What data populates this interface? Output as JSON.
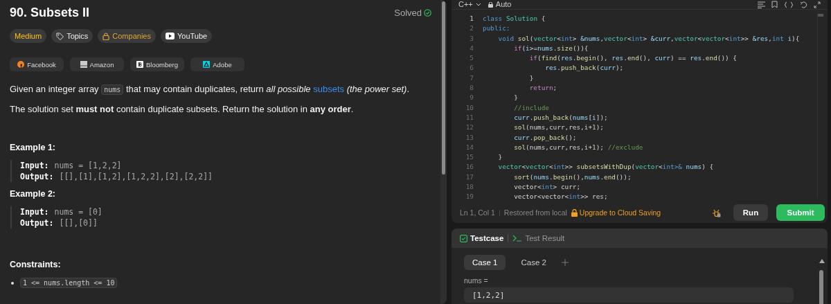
{
  "problem": {
    "title": "90. Subsets II",
    "status": "Solved",
    "tags": [
      {
        "label": "Medium",
        "kind": "difficulty"
      },
      {
        "label": "Topics",
        "kind": "topics"
      },
      {
        "label": "Companies",
        "kind": "companies"
      },
      {
        "label": "YouTube",
        "kind": "youtube"
      }
    ],
    "companies": [
      {
        "name": "Facebook",
        "kind": "facebook"
      },
      {
        "name": "Amazon",
        "kind": "amazon"
      },
      {
        "name": "Bloomberg",
        "kind": "bloomberg"
      },
      {
        "name": "Adobe",
        "kind": "adobe"
      }
    ],
    "paragraphs": [
      [
        {
          "kind": "text",
          "text": "Given an integer array "
        },
        {
          "kind": "code",
          "text": "nums"
        },
        {
          "kind": "text",
          "text": " that may contain duplicates, return *all possible* "
        },
        {
          "kind": "link",
          "text": "subsets"
        },
        {
          "kind": "text",
          "text": " *(the power set)*."
        }
      ],
      [
        {
          "kind": "text",
          "text": "The solution set **must not** contain duplicate subsets. Return the solution in **any order**."
        }
      ]
    ],
    "examples": [
      {
        "title": "Example 1:",
        "lines": [
          {
            "label": "Input:",
            "value": "nums = [1,2,2]"
          },
          {
            "label": "Output:",
            "value": "[[],[1],[1,2],[1,2,2],[2],[2,2]]"
          }
        ]
      },
      {
        "title": "Example 2:",
        "lines": [
          {
            "label": "Input:",
            "value": "nums = [0]"
          },
          {
            "label": "Output:",
            "value": "[[],[0]]"
          }
        ]
      }
    ],
    "constraints": {
      "title": "Constraints:",
      "items": [
        "1 <= nums.length <= 10"
      ]
    }
  },
  "editor": {
    "language": "C++",
    "mode": "Auto",
    "lines": [
      {
        "number": "1",
        "active": true,
        "tokens": [
          {
            "text": "class",
            "kind": "keyword"
          },
          {
            "text": " Solution",
            "kind": "type"
          },
          {
            "text": " {",
            "kind": "plain"
          }
        ]
      },
      {
        "number": "2",
        "active": false,
        "tokens": [
          {
            "text": "public:",
            "kind": "keyword"
          }
        ]
      },
      {
        "number": "3",
        "active": false,
        "tokens": [
          {
            "text": "    void",
            "kind": "keyword"
          },
          {
            "text": " sol",
            "kind": "function"
          },
          {
            "text": "(",
            "kind": "plain"
          },
          {
            "text": "vector",
            "kind": "type"
          },
          {
            "text": "<",
            "kind": "plain"
          },
          {
            "text": "int",
            "kind": "keyword"
          },
          {
            "text": "> ",
            "kind": "plain"
          },
          {
            "text": "&nums",
            "kind": "variable"
          },
          {
            "text": ",",
            "kind": "plain"
          },
          {
            "text": "vector",
            "kind": "type"
          },
          {
            "text": "<",
            "kind": "plain"
          },
          {
            "text": "int",
            "kind": "keyword"
          },
          {
            "text": "> ",
            "kind": "plain"
          },
          {
            "text": "&curr",
            "kind": "variable"
          },
          {
            "text": ",",
            "kind": "plain"
          },
          {
            "text": "vector",
            "kind": "type"
          },
          {
            "text": "<",
            "kind": "plain"
          },
          {
            "text": "vector",
            "kind": "type"
          },
          {
            "text": "<",
            "kind": "plain"
          },
          {
            "text": "int",
            "kind": "keyword"
          },
          {
            "text": ">> ",
            "kind": "plain"
          },
          {
            "text": "&res",
            "kind": "variable"
          },
          {
            "text": ",",
            "kind": "plain"
          },
          {
            "text": "int",
            "kind": "keyword"
          },
          {
            "text": " i",
            "kind": "variable"
          },
          {
            "text": "){",
            "kind": "plain"
          }
        ]
      },
      {
        "number": "4",
        "active": false,
        "tokens": [
          {
            "text": "        if",
            "kind": "control"
          },
          {
            "text": "(",
            "kind": "plain"
          },
          {
            "text": "i",
            "kind": "variable"
          },
          {
            "text": ">=",
            "kind": "plain"
          },
          {
            "text": "nums",
            "kind": "variable"
          },
          {
            "text": ".",
            "kind": "plain"
          },
          {
            "text": "size",
            "kind": "function"
          },
          {
            "text": "()){",
            "kind": "plain"
          }
        ]
      },
      {
        "number": "5",
        "active": false,
        "tokens": [
          {
            "text": "            if",
            "kind": "control"
          },
          {
            "text": "(",
            "kind": "plain"
          },
          {
            "text": "find",
            "kind": "function"
          },
          {
            "text": "(",
            "kind": "plain"
          },
          {
            "text": "res",
            "kind": "variable"
          },
          {
            "text": ".",
            "kind": "plain"
          },
          {
            "text": "begin",
            "kind": "function"
          },
          {
            "text": "(), ",
            "kind": "plain"
          },
          {
            "text": "res",
            "kind": "variable"
          },
          {
            "text": ".",
            "kind": "plain"
          },
          {
            "text": "end",
            "kind": "function"
          },
          {
            "text": "(), ",
            "kind": "plain"
          },
          {
            "text": "curr",
            "kind": "variable"
          },
          {
            "text": ") == ",
            "kind": "plain"
          },
          {
            "text": "res",
            "kind": "variable"
          },
          {
            "text": ".",
            "kind": "plain"
          },
          {
            "text": "end",
            "kind": "function"
          },
          {
            "text": "()) {",
            "kind": "plain"
          }
        ]
      },
      {
        "number": "6",
        "active": false,
        "tokens": [
          {
            "text": "                res",
            "kind": "variable"
          },
          {
            "text": ".",
            "kind": "plain"
          },
          {
            "text": "push_back",
            "kind": "function"
          },
          {
            "text": "(",
            "kind": "plain"
          },
          {
            "text": "curr",
            "kind": "variable"
          },
          {
            "text": ");",
            "kind": "plain"
          }
        ]
      },
      {
        "number": "7",
        "active": false,
        "tokens": [
          {
            "text": "            }",
            "kind": "plain"
          }
        ]
      },
      {
        "number": "8",
        "active": false,
        "tokens": [
          {
            "text": "            return",
            "kind": "control"
          },
          {
            "text": ";",
            "kind": "plain"
          }
        ]
      },
      {
        "number": "9",
        "active": false,
        "tokens": [
          {
            "text": "        }",
            "kind": "plain"
          }
        ]
      },
      {
        "number": "10",
        "active": false,
        "tokens": [
          {
            "text": "        //include",
            "kind": "comment"
          }
        ]
      },
      {
        "number": "11",
        "active": false,
        "tokens": [
          {
            "text": "        curr",
            "kind": "variable"
          },
          {
            "text": ".",
            "kind": "plain"
          },
          {
            "text": "push_back",
            "kind": "function"
          },
          {
            "text": "(",
            "kind": "plain"
          },
          {
            "text": "nums",
            "kind": "variable"
          },
          {
            "text": "[",
            "kind": "plain"
          },
          {
            "text": "i",
            "kind": "variable"
          },
          {
            "text": "]);",
            "kind": "plain"
          }
        ]
      },
      {
        "number": "12",
        "active": false,
        "tokens": [
          {
            "text": "        sol",
            "kind": "function"
          },
          {
            "text": "(nums,curr,res,i+",
            "kind": "plain"
          },
          {
            "text": "1",
            "kind": "number"
          },
          {
            "text": ");",
            "kind": "plain"
          }
        ]
      },
      {
        "number": "13",
        "active": false,
        "tokens": [
          {
            "text": "        curr",
            "kind": "variable"
          },
          {
            "text": ".",
            "kind": "plain"
          },
          {
            "text": "pop_back",
            "kind": "function"
          },
          {
            "text": "();",
            "kind": "plain"
          }
        ]
      },
      {
        "number": "14",
        "active": false,
        "tokens": [
          {
            "text": "        sol",
            "kind": "function"
          },
          {
            "text": "(nums,curr,res,i+",
            "kind": "plain"
          },
          {
            "text": "1",
            "kind": "number"
          },
          {
            "text": ");",
            "kind": "plain"
          },
          {
            "text": " //exclude",
            "kind": "comment"
          }
        ]
      },
      {
        "number": "15",
        "active": false,
        "tokens": [
          {
            "text": "    }",
            "kind": "plain"
          }
        ]
      },
      {
        "number": "16",
        "active": false,
        "tokens": [
          {
            "text": "    vector",
            "kind": "type"
          },
          {
            "text": "<",
            "kind": "plain"
          },
          {
            "text": "vector",
            "kind": "type"
          },
          {
            "text": "<",
            "kind": "plain"
          },
          {
            "text": "int",
            "kind": "keyword"
          },
          {
            "text": ">> ",
            "kind": "plain"
          },
          {
            "text": "subsetsWithDup",
            "kind": "function"
          },
          {
            "text": "(",
            "kind": "plain"
          },
          {
            "text": "vector",
            "kind": "type"
          },
          {
            "text": "<",
            "kind": "plain"
          },
          {
            "text": "int",
            "kind": "keyword"
          },
          {
            "text": ">&",
            "kind": "keyword"
          },
          {
            "text": " nums",
            "kind": "variable"
          },
          {
            "text": ") {",
            "kind": "plain"
          }
        ]
      },
      {
        "number": "17",
        "active": false,
        "tokens": [
          {
            "text": "        sort",
            "kind": "function"
          },
          {
            "text": "(",
            "kind": "plain"
          },
          {
            "text": "nums",
            "kind": "variable"
          },
          {
            "text": ".",
            "kind": "plain"
          },
          {
            "text": "begin",
            "kind": "function"
          },
          {
            "text": "(),",
            "kind": "plain"
          },
          {
            "text": "nums",
            "kind": "variable"
          },
          {
            "text": ".",
            "kind": "plain"
          },
          {
            "text": "end",
            "kind": "function"
          },
          {
            "text": "());",
            "kind": "plain"
          }
        ]
      },
      {
        "number": "18",
        "active": false,
        "tokens": [
          {
            "text": "        vector<",
            "kind": "plain"
          },
          {
            "text": "int",
            "kind": "keyword"
          },
          {
            "text": "> curr;",
            "kind": "plain"
          }
        ]
      },
      {
        "number": "19",
        "active": false,
        "tokens": [
          {
            "text": "        vector<vector<",
            "kind": "plain"
          },
          {
            "text": "int",
            "kind": "keyword"
          },
          {
            "text": ">> res;",
            "kind": "plain"
          }
        ]
      }
    ],
    "status": {
      "cursor": "Ln 1, Col 1",
      "saved": "Restored from local",
      "upgrade": "Upgrade to Cloud Saving"
    },
    "buttons": [
      {
        "label": "Run",
        "kind": "run"
      },
      {
        "label": "Submit",
        "kind": "submit"
      }
    ]
  },
  "testcase": {
    "tabs": [
      {
        "label": "Testcase",
        "kind": "testcase",
        "selected": true
      },
      {
        "label": "Test Result",
        "kind": "result",
        "selected": false
      }
    ],
    "cases": [
      {
        "label": "Case 1",
        "selected": true
      },
      {
        "label": "Case 2",
        "selected": false
      }
    ],
    "field_label": "nums =",
    "field_value": "[1,2,2]"
  }
}
